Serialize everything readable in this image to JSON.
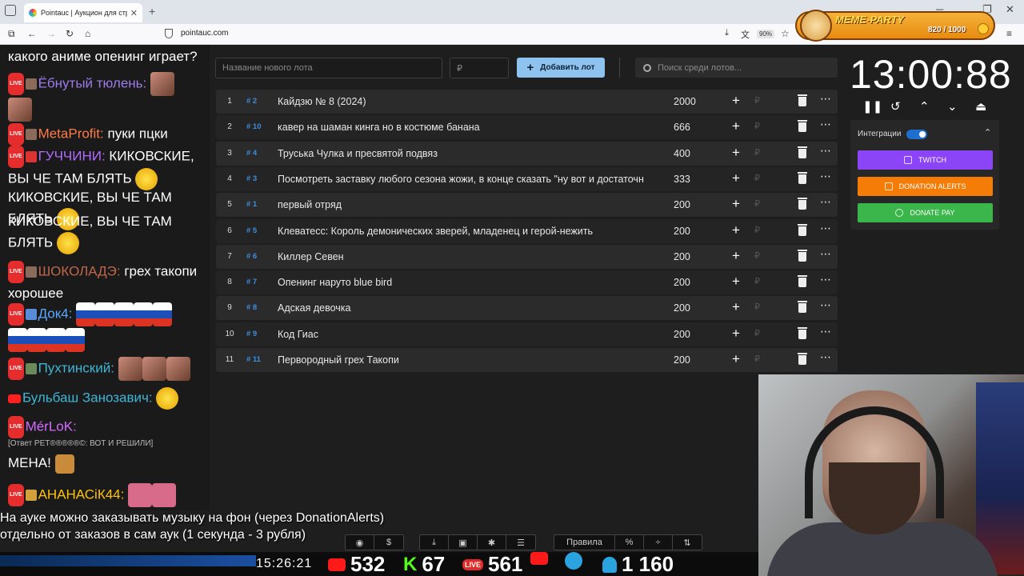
{
  "browser": {
    "tab_title": "Pointauc | Аукцион для стрима",
    "url": "pointauc.com",
    "zoom": "90%"
  },
  "widget": {
    "title": "MEME-PARTY",
    "score": "820 / 1000"
  },
  "chat": [
    {
      "user": "",
      "text": "какого аниме опенинг играет?"
    },
    {
      "user": "Ёбнутый тюлень:",
      "text": "",
      "color": "#9f7aea"
    },
    {
      "user": "MetaProfit:",
      "text": "пуки пцки",
      "color": "#ff7a45"
    },
    {
      "user": "ГУЧЧИНИ:",
      "text": "КИКОВСКИЕ, ВЫ ЧЕ ТАМ БЛЯТЬ",
      "color": "#b06bff"
    },
    {
      "user": "",
      "text": "КИКОВСКИЕ, ВЫ ЧЕ ТАМ БЛЯТЬ"
    },
    {
      "user": "",
      "text": "КИКОВСКИЕ, ВЫ ЧЕ ТАМ БЛЯТЬ"
    },
    {
      "user": "ШОКОЛАДЭ:",
      "text": "грех такопи хорошее",
      "color": "#c0674a"
    },
    {
      "user": "Док4:",
      "text": "",
      "color": "#5aa8ff"
    },
    {
      "user": "Пухтинский:",
      "text": "",
      "color": "#3fb6d8"
    },
    {
      "user": "Бульбаш Занозавич:",
      "text": "",
      "color": "#3fb6d8"
    },
    {
      "user": "MérLoK:",
      "text": "",
      "color": "#d36bff"
    },
    {
      "user": "",
      "text": "[Ответ PET®®®®®©: ВОТ И РЕШИЛИ]"
    },
    {
      "user": "",
      "text": "МЕНА!"
    },
    {
      "user": "АНАНАСіК44:",
      "text": "",
      "color": "#ffc107"
    }
  ],
  "lots": {
    "new_lot_placeholder": "Название нового лота",
    "amount_placeholder": "₽",
    "add_button": "Добавить лот",
    "search_placeholder": "Поиск среди лотов...",
    "rows": [
      {
        "n": "1",
        "id": "# 2",
        "name": "Кайдзю № 8 (2024)",
        "amount": "2000"
      },
      {
        "n": "2",
        "id": "# 10",
        "name": "кавер на шаман кинга но в костюме банана",
        "amount": "666"
      },
      {
        "n": "3",
        "id": "# 4",
        "name": "Труська Чулка и пресвятой подвяз",
        "amount": "400"
      },
      {
        "n": "4",
        "id": "# 3",
        "name": "Посмотреть заставку любого сезона жожи, в конце сказать \"ну вот и достаточн",
        "amount": "333"
      },
      {
        "n": "5",
        "id": "# 1",
        "name": "первый отряд",
        "amount": "200"
      },
      {
        "n": "6",
        "id": "# 5",
        "name": "Клеватесс: Король демонических зверей, младенец и герой-нежить",
        "amount": "200"
      },
      {
        "n": "7",
        "id": "# 6",
        "name": "Киллер Севен",
        "amount": "200"
      },
      {
        "n": "8",
        "id": "# 7",
        "name": "Опенинг наруто blue bird",
        "amount": "200"
      },
      {
        "n": "9",
        "id": "# 8",
        "name": "Адская девочка",
        "amount": "200"
      },
      {
        "n": "10",
        "id": "# 9",
        "name": "Код Гиас",
        "amount": "200"
      },
      {
        "n": "11",
        "id": "# 11",
        "name": "Первородный грех Такопи",
        "amount": "200"
      }
    ]
  },
  "timer": {
    "value": "13:00:88"
  },
  "integrations": {
    "label": "Интеграции",
    "twitch": "TWITCH",
    "donationalerts": "DONATION ALERTS",
    "donatepay": "DONATE PAY",
    "colors": {
      "twitch": "#8c44f7",
      "donationalerts": "#f57d07",
      "donatepay": "#3bb64a"
    }
  },
  "overlay": {
    "line1": "На ауке можно заказывать музыку на фон (через DonationAlerts)",
    "line2": "отдельно от заказов в сам аук (1 секунда - 3 рубля)",
    "rules": "Правила"
  },
  "status": {
    "clock": "15:26:21",
    "youtube": "532",
    "kick": "67",
    "live": "561",
    "users": "1 160"
  }
}
